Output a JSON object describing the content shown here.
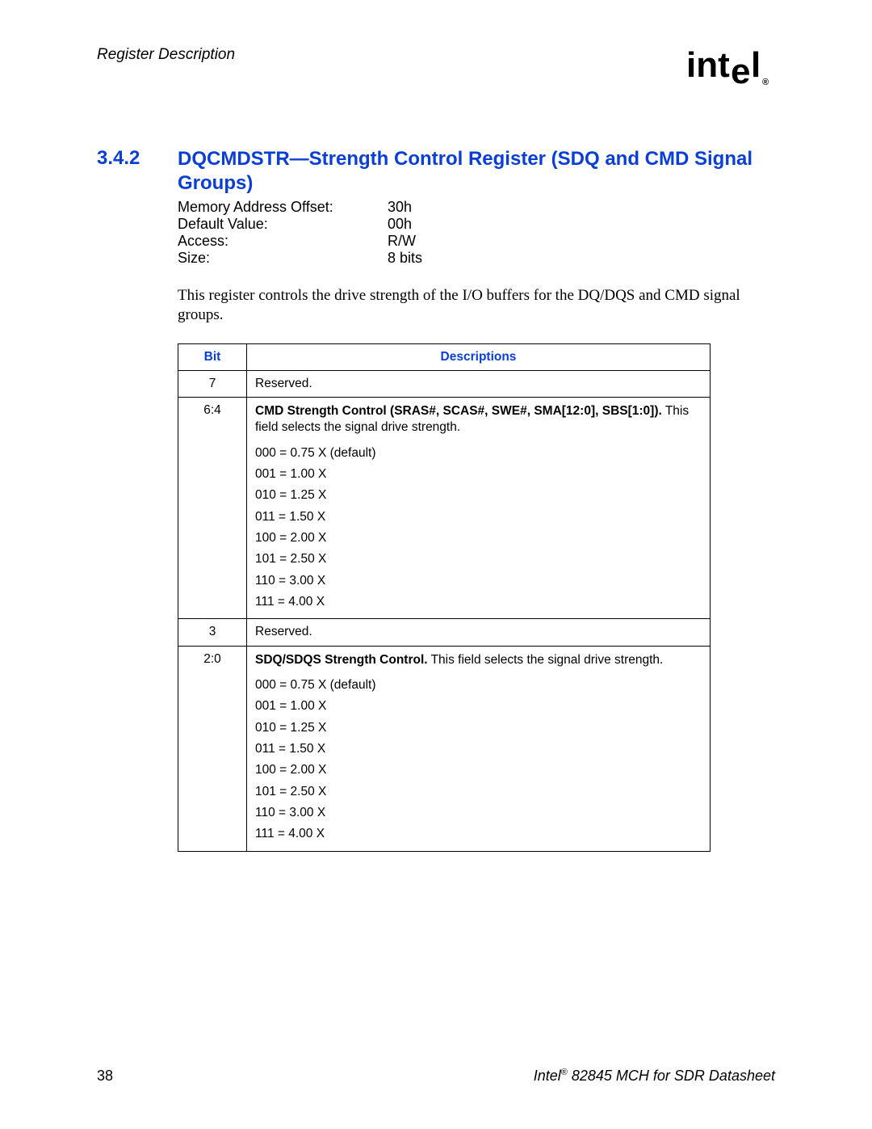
{
  "header": {
    "chapter": "Register Description",
    "logo_text": "intel",
    "logo_trademark": "®"
  },
  "section": {
    "number": "3.4.2",
    "title": "DQCMDSTR—Strength Control Register (SDQ and CMD Signal Groups)"
  },
  "info": {
    "rows": [
      {
        "label": "Memory Address Offset:",
        "value": "30h"
      },
      {
        "label": "Default Value:",
        "value": "00h"
      },
      {
        "label": "Access:",
        "value": "R/W"
      },
      {
        "label": "Size:",
        "value": "8 bits"
      }
    ]
  },
  "description": "This register controls the drive strength of the I/O buffers for the DQ/DQS and CMD signal groups.",
  "table": {
    "headers": {
      "bit": "Bit",
      "desc": "Descriptions"
    },
    "rows": [
      {
        "bit": "7",
        "desc_plain": "Reserved."
      },
      {
        "bit": "6:4",
        "lead_bold": "CMD Strength Control (SRAS#, SCAS#, SWE#, SMA[12:0], SBS[1:0]).",
        "lead_rest": " This field selects the signal drive strength.",
        "lines": [
          "000 = 0.75 X (default)",
          "001 = 1.00 X",
          "010 = 1.25 X",
          "011 = 1.50 X",
          "100 = 2.00 X",
          "101 = 2.50 X",
          "110 = 3.00 X",
          "111 = 4.00 X"
        ]
      },
      {
        "bit": "3",
        "desc_plain": "Reserved."
      },
      {
        "bit": "2:0",
        "lead_bold": "SDQ/SDQS Strength Control.",
        "lead_rest": " This field selects the signal drive strength.",
        "lines": [
          "000 = 0.75 X (default)",
          "001 = 1.00 X",
          "010 = 1.25 X",
          "011 = 1.50 X",
          "100 = 2.00 X",
          "101 = 2.50 X",
          "110 = 3.00 X",
          "111 = 4.00 X"
        ]
      }
    ]
  },
  "footer": {
    "page": "38",
    "doc_prefix": "Intel",
    "doc_sup": "®",
    "doc_suffix": " 82845 MCH for SDR Datasheet"
  }
}
